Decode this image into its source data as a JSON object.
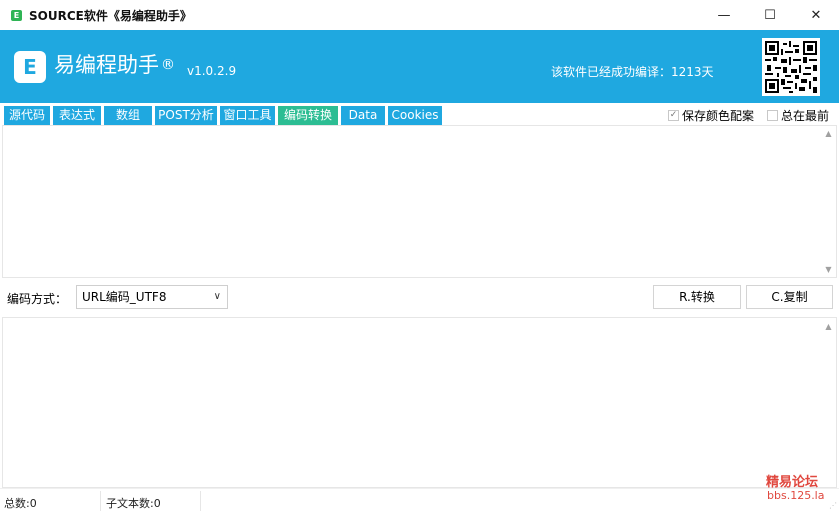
{
  "window": {
    "title": "SOURCE软件《易编程助手》",
    "app_icon_letter": "E",
    "controls": {
      "minimize": "—",
      "maximize": "☐",
      "close": "✕"
    }
  },
  "header": {
    "logo_letter": "E",
    "app_name": "易编程助手",
    "reg_mark": "®",
    "version": "v1.0.2.9",
    "compile_info": "该软件已经成功编译：1213天",
    "qr_icon": "qr-code-icon",
    "bg_color": "#1fa8e0"
  },
  "tabs": [
    {
      "label": "源代码"
    },
    {
      "label": "表达式"
    },
    {
      "label": "数组"
    },
    {
      "label": "POST分析"
    },
    {
      "label": "窗口工具"
    },
    {
      "label": "编码转换",
      "active": true
    },
    {
      "label": "Data"
    },
    {
      "label": "Cookies"
    }
  ],
  "tab_colors": {
    "normal": "#1fa8e0",
    "active": "#2cbd93"
  },
  "options": {
    "save_color": {
      "label": "保存颜色配案",
      "checked": true
    },
    "always_on_top": {
      "label": "总在最前",
      "checked": false
    }
  },
  "input_area": {
    "value": ""
  },
  "encoding": {
    "label": "编码方式：",
    "selected": "URL编码_UTF8",
    "convert_button": "R.转换",
    "copy_button": "C.复制"
  },
  "output_area": {
    "value": ""
  },
  "status": {
    "total": "总数:0",
    "substring_count": "子文本数:0"
  },
  "watermark": {
    "line1": "精易论坛",
    "line2": "bbs.125.la"
  }
}
